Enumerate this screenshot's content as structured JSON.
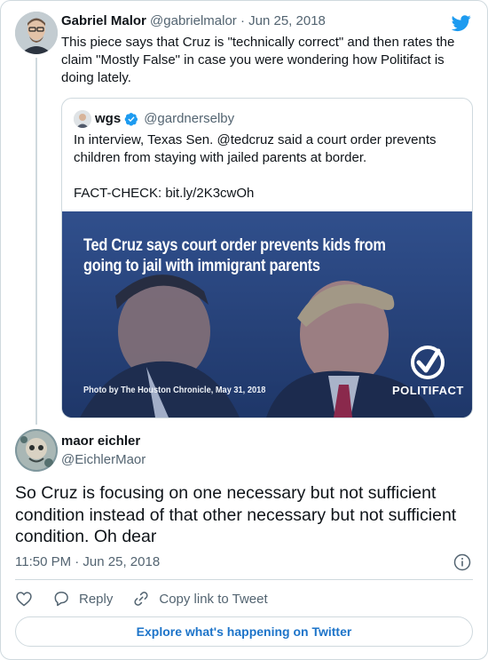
{
  "parent_tweet": {
    "name": "Gabriel Malor",
    "handle": "@gabrielmalor",
    "date": "Jun 25, 2018",
    "text": "This piece says that Cruz is \"technically correct\" and then rates the claim \"Mostly False\" in case you were wondering how Politifact is doing lately."
  },
  "quoted_tweet": {
    "name": "wgs",
    "handle": "@gardnerselby",
    "text_line1": "In interview, Texas Sen. @tedcruz said a court order prevents children from staying with jailed parents at border.",
    "text_line2": "FACT-CHECK: bit.ly/2K3cwOh",
    "image": {
      "headline_line1": "Ted Cruz says court order prevents kids from",
      "headline_line2": "going to jail with immigrant parents",
      "credit": "Photo by The Houston Chronicle, May 31, 2018",
      "brand": "POLITIFACT"
    }
  },
  "reply_tweet": {
    "name": "maor eichler",
    "handle": "@EichlerMaor",
    "text": "So Cruz is focusing on one necessary but not sufficient condition instead of that other necessary but not sufficient condition. Oh dear",
    "timestamp": "11:50 PM · Jun 25, 2018"
  },
  "actions": {
    "like_icon": "heart-icon",
    "reply_label": "Reply",
    "copy_label": "Copy link to Tweet"
  },
  "explore_label": "Explore what's happening on Twitter",
  "colors": {
    "twitter_blue": "#1d9bf0",
    "text_primary": "#0f1419",
    "text_secondary": "#536471",
    "border": "#cfd9de",
    "link": "#1d74c9"
  }
}
